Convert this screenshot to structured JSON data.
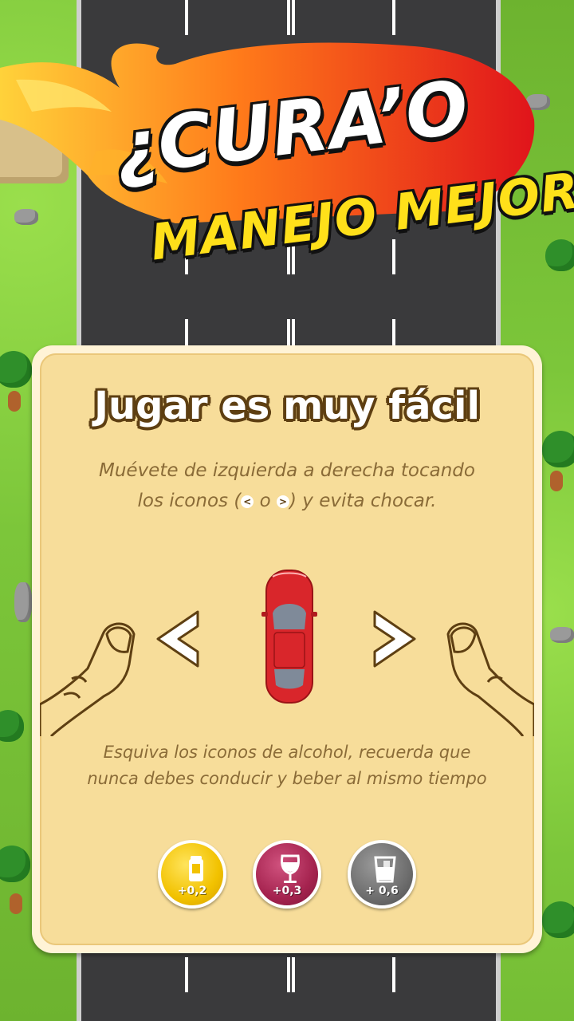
{
  "logo": {
    "line1": "¿CURA’O",
    "line2": "MANEJO MEJOR ?"
  },
  "panel": {
    "title": "Jugar es muy fácil",
    "instruction_top": {
      "part1": "Muévete de izquierda a derecha tocando los iconos (",
      "left_icon": "<",
      "middle": " o ",
      "right_icon": ">",
      "part2": ") y evita chocar."
    },
    "instruction_bottom": "Esquiva los iconos de alcohol, recuerda que nunca debes conducir y beber al mismo tiempo",
    "controls": {
      "left_label": "<",
      "right_label": ">"
    },
    "alcohol_icons": [
      {
        "icon": "beer-can-icon",
        "value": "+0,2",
        "color": "#f2c200"
      },
      {
        "icon": "wine-glass-icon",
        "value": "+0,3",
        "color": "#a5234f"
      },
      {
        "icon": "liquor-glass-icon",
        "value": "+ 0,6",
        "color": "#6e6e6e"
      }
    ]
  },
  "colors": {
    "road": "#3a3a3c",
    "grass": "#7cc63a",
    "panel": "#f7dd9a",
    "text_brown": "#8a6b37",
    "car": "#d9262b",
    "logo_white": "#ffffff",
    "logo_yellow": "#ffe01a"
  }
}
